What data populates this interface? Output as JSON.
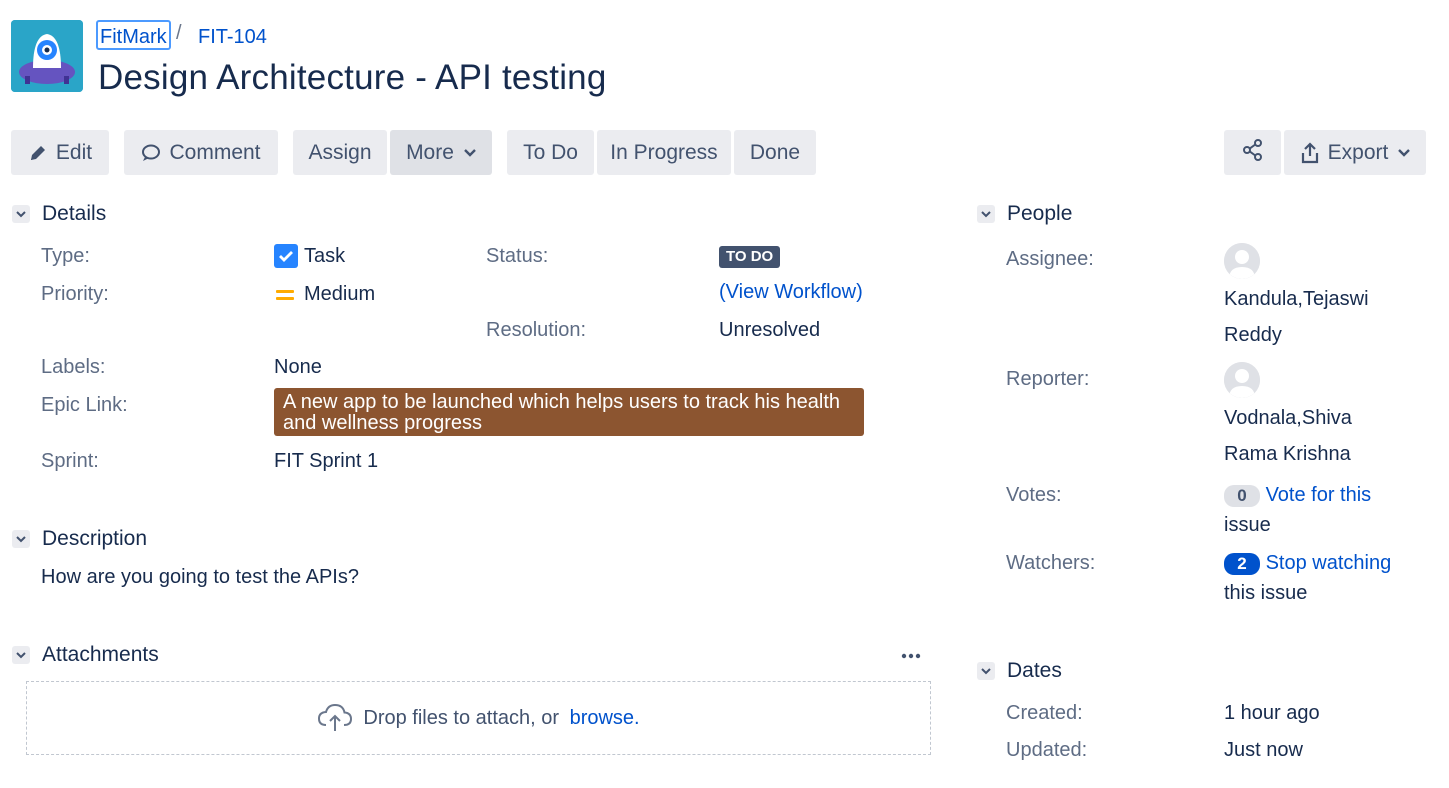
{
  "breadcrumb": {
    "project": "FitMark",
    "separator": "/",
    "issue_key": "FIT-104"
  },
  "issue": {
    "title": "Design Architecture - API testing"
  },
  "toolbar": {
    "edit": "Edit",
    "comment": "Comment",
    "assign": "Assign",
    "more": "More",
    "todo": "To Do",
    "in_progress": "In Progress",
    "done": "Done",
    "export": "Export"
  },
  "details": {
    "heading": "Details",
    "type_label": "Type:",
    "type_value": "Task",
    "priority_label": "Priority:",
    "priority_value": "Medium",
    "status_label": "Status:",
    "status_value": "TO DO",
    "workflow_open": "(",
    "workflow_link": "View Workflow",
    "workflow_close": ")",
    "resolution_label": "Resolution:",
    "resolution_value": "Unresolved",
    "labels_label": "Labels:",
    "labels_value": "None",
    "epic_label": "Epic Link:",
    "epic_value": "A new app to be launched which helps users to track his health and wellness progress",
    "sprint_label": "Sprint:",
    "sprint_value": "FIT Sprint 1"
  },
  "description": {
    "heading": "Description",
    "text": "How are you going to test the APIs?"
  },
  "attachments": {
    "heading": "Attachments",
    "drop_text": "Drop files to attach, or ",
    "browse": "browse."
  },
  "people": {
    "heading": "People",
    "assignee_label": "Assignee:",
    "assignee_line1": "Kandula,Tejaswi",
    "assignee_line2": "Reddy",
    "reporter_label": "Reporter:",
    "reporter_line1": "Vodnala,Shiva",
    "reporter_line2": "Rama Krishna",
    "votes_label": "Votes:",
    "votes_count": "0",
    "votes_link_1": "Vote for this",
    "votes_link_2": "issue",
    "watchers_label": "Watchers:",
    "watchers_count": "2",
    "watchers_link_1": "Stop watching",
    "watchers_link_2": "this issue"
  },
  "dates": {
    "heading": "Dates",
    "created_label": "Created:",
    "created_value": "1 hour ago",
    "updated_label": "Updated:",
    "updated_value": "Just now"
  },
  "colors": {
    "link": "#0052cc",
    "button_bg": "#ebecf0",
    "status_bg": "#42526e",
    "epic_bg": "#8c5530",
    "priority_medium": "#ffab00",
    "checkbox_blue": "#2684ff",
    "watch_badge": "#0052cc"
  }
}
